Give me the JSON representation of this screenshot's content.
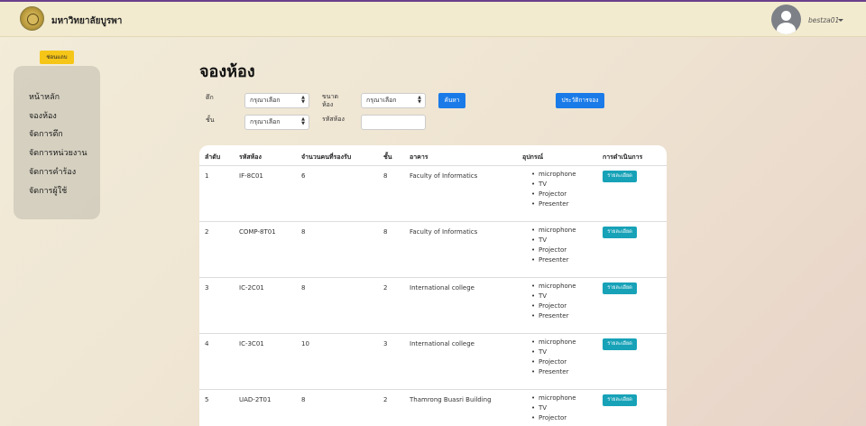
{
  "header": {
    "university_name": "มหาวิทยาลัยบูรพา",
    "username": "bestza01"
  },
  "sidebar": {
    "toggle_label": "ซ่อนแถบ",
    "items": [
      {
        "label": "หน้าหลัก"
      },
      {
        "label": "จองห้อง"
      },
      {
        "label": "จัดการตึก"
      },
      {
        "label": "จัดการหน่วยงาน"
      },
      {
        "label": "จัดการคำร้อง"
      },
      {
        "label": "จัดการผู้ใช้"
      }
    ]
  },
  "page": {
    "title": "จองห้อง"
  },
  "filters": {
    "building_label": "ตึก",
    "building_value": "กรุณาเลือก",
    "size_label": "ขนาดห้อง",
    "size_value": "กรุณาเลือก",
    "floor_label": "ชั้น",
    "floor_value": "กรุณาเลือก",
    "room_code_label": "รหัสห้อง",
    "room_code_value": "",
    "search_button": "ค้นหา",
    "history_button": "ประวัติการจอง"
  },
  "table": {
    "headers": [
      "ลำดับ",
      "รหัสห้อง",
      "จำนวนคนที่รองรับ",
      "ชั้น",
      "อาคาร",
      "อุปกรณ์",
      "การดำเนินการ"
    ],
    "detail_label": "รายละเอียด",
    "rows": [
      {
        "no": "1",
        "code": "IF-8C01",
        "capacity": "6",
        "floor": "8",
        "building": "Faculty of Informatics",
        "equipment": [
          "microphone",
          "TV",
          "Projector",
          "Presenter"
        ]
      },
      {
        "no": "2",
        "code": "COMP-8T01",
        "capacity": "8",
        "floor": "8",
        "building": "Faculty of Informatics",
        "equipment": [
          "microphone",
          "TV",
          "Projector",
          "Presenter"
        ]
      },
      {
        "no": "3",
        "code": "IC-2C01",
        "capacity": "8",
        "floor": "2",
        "building": "International college",
        "equipment": [
          "microphone",
          "TV",
          "Projector",
          "Presenter"
        ]
      },
      {
        "no": "4",
        "code": "IC-3C01",
        "capacity": "10",
        "floor": "3",
        "building": "International college",
        "equipment": [
          "microphone",
          "TV",
          "Projector",
          "Presenter"
        ]
      },
      {
        "no": "5",
        "code": "UAD-2T01",
        "capacity": "8",
        "floor": "2",
        "building": "Thamrong Buasri Building",
        "equipment": [
          "microphone",
          "TV",
          "Projector"
        ]
      }
    ]
  }
}
